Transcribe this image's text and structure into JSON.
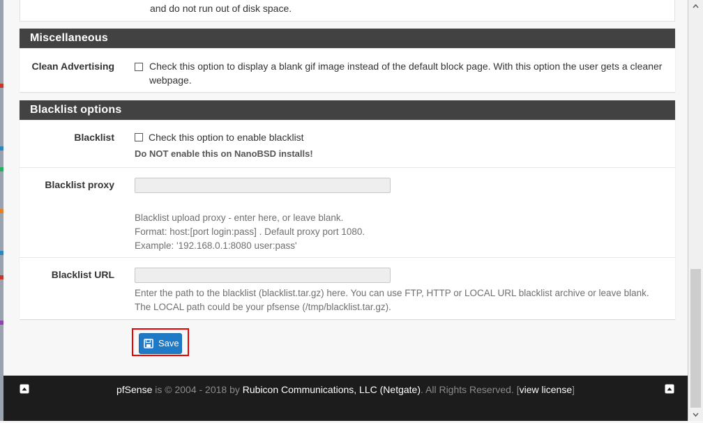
{
  "top_panel": {
    "desc": "and do not run out of disk space."
  },
  "misc": {
    "heading": "Miscellaneous",
    "clean_ads": {
      "label": "Clean Advertising",
      "text": "Check this option to display a blank gif image instead of the default block page. With this option the user gets a cleaner webpage."
    }
  },
  "blacklist": {
    "heading": "Blacklist options",
    "enable": {
      "label": "Blacklist",
      "text": "Check this option to enable blacklist",
      "warning": "Do NOT enable this on NanoBSD installs!"
    },
    "proxy": {
      "label": "Blacklist proxy",
      "value": "",
      "help_1": "Blacklist upload proxy - enter here, or leave blank.",
      "help_2": "Format: host:[port login:pass] . Default proxy port 1080.",
      "help_3": "Example: '192.168.0.1:8080 user:pass'"
    },
    "url": {
      "label": "Blacklist URL",
      "value": "",
      "help_1": "Enter the path to the blacklist (blacklist.tar.gz) here. You can use FTP, HTTP or LOCAL URL blacklist archive or leave blank.",
      "help_2": "The LOCAL path could be your pfsense (/tmp/blacklist.tar.gz)."
    }
  },
  "save_button": {
    "label": "Save",
    "icon": "floppy-disk-icon",
    "color": "#1e7ac6"
  },
  "footer": {
    "brand": "pfSense",
    "is_copy": " is © 2004 - 2018 by ",
    "company": "Rubicon Communications, LLC (Netgate)",
    "rights": ". All Rights Reserved. [",
    "license_link": "view license",
    "close_bracket": "]",
    "icon": "arrow-up-box-icon"
  },
  "colors": {
    "panel_heading_bg": "#424242",
    "footer_bg": "#1c1c1c",
    "highlight_border": "#ee0000"
  }
}
